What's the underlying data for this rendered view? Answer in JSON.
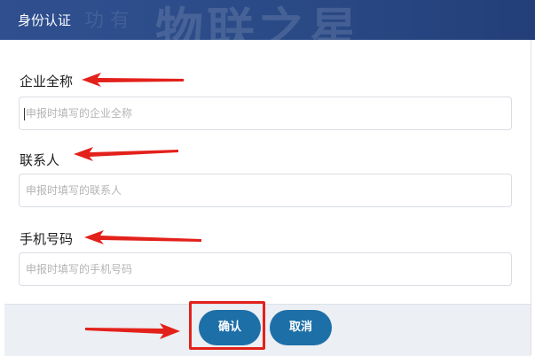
{
  "dialog": {
    "title": "身份认证"
  },
  "fields": [
    {
      "label": "企业全称",
      "placeholder": "申报时填写的企业全称"
    },
    {
      "label": "联系人",
      "placeholder": "申报时填写的联系人"
    },
    {
      "label": "手机号码",
      "placeholder": "申报时填写的手机号码"
    }
  ],
  "buttons": {
    "confirm": "确认",
    "cancel": "取消"
  },
  "colors": {
    "header": "#2f4f8f",
    "button": "#1d6fa8",
    "annotation": "#e3211b"
  },
  "annotations": {
    "arrow_icon": "left-pointing-red-arrow",
    "highlight": "red-rectangle-around-confirm"
  }
}
